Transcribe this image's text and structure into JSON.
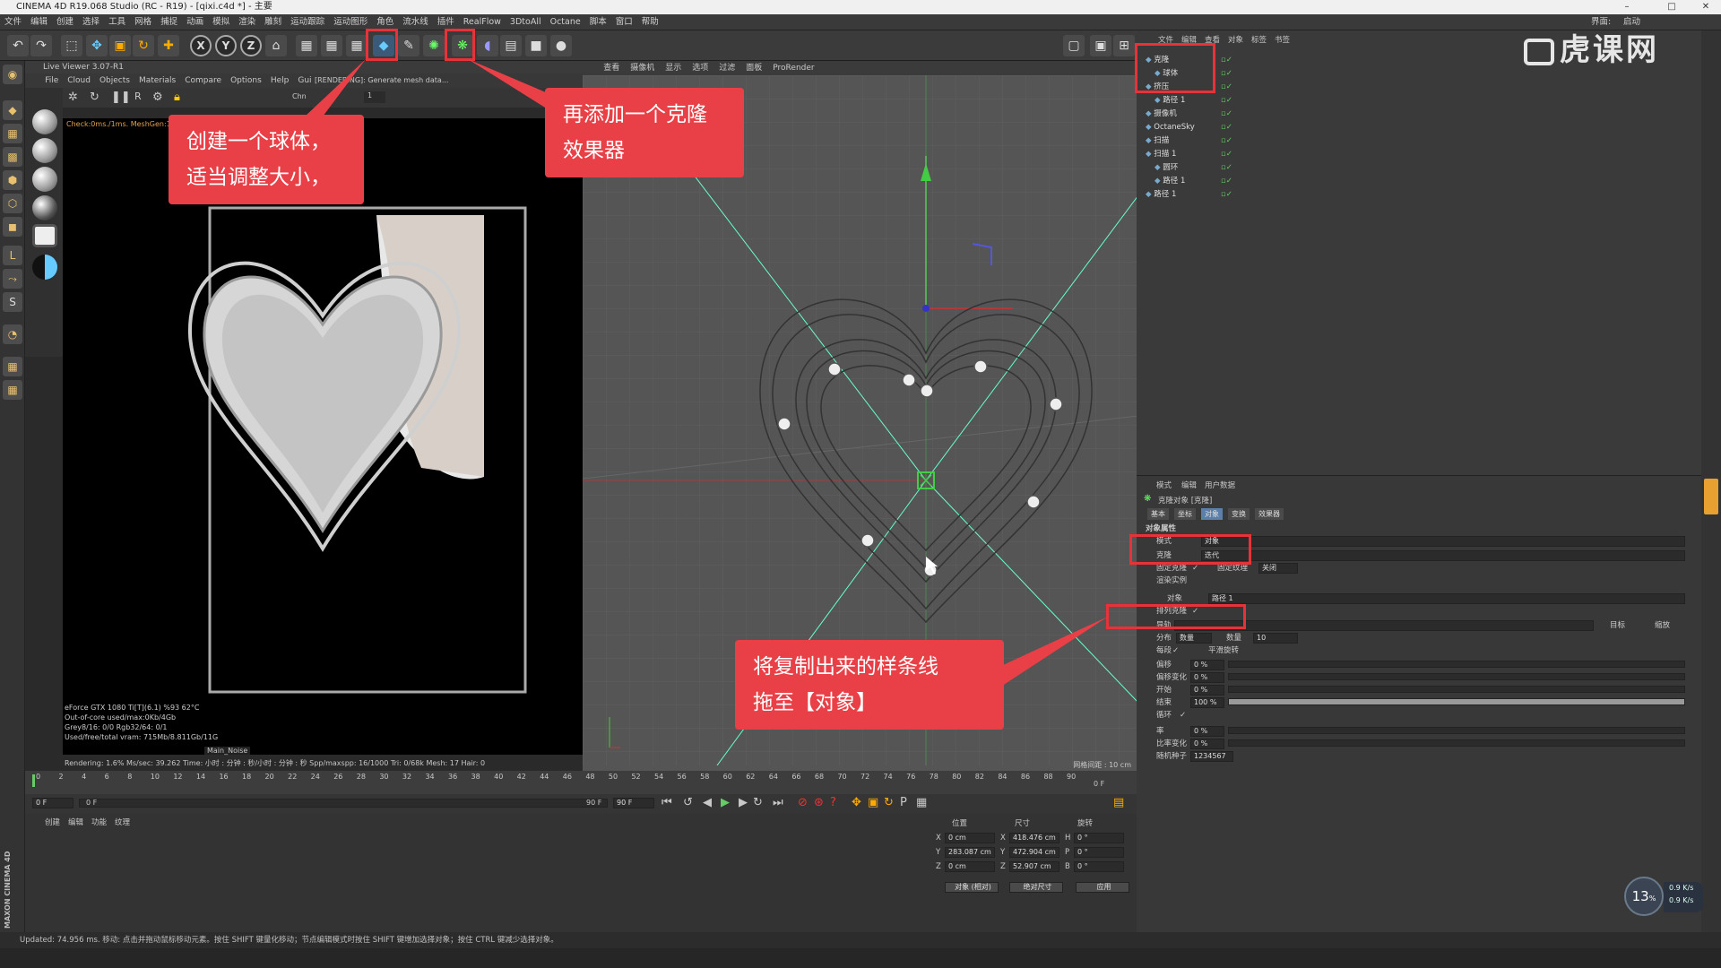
{
  "app": {
    "title": "CINEMA 4D R19.068 Studio (RC - R19) - [qixi.c4d *] - 主要"
  },
  "menu": [
    "文件",
    "编辑",
    "创建",
    "选择",
    "工具",
    "网格",
    "捕捉",
    "动画",
    "模拟",
    "渲染",
    "雕刻",
    "运动跟踪",
    "运动图形",
    "角色",
    "流水线",
    "插件",
    "RealFlow",
    "3DtoAll",
    "Octane",
    "脚本",
    "窗口",
    "帮助"
  ],
  "menu_right": [
    "界面:",
    "启动"
  ],
  "toolbar": {
    "axis_x": "X",
    "axis_y": "Y",
    "axis_z": "Z"
  },
  "live_viewer": {
    "title": "Live Viewer 3.07-R1",
    "menu": [
      "File",
      "Cloud",
      "Objects",
      "Materials",
      "Compare",
      "Options",
      "Help",
      "Gui"
    ],
    "render_msg": "[RENDERING]: Generate mesh data...",
    "check_msg": "Check:0ms./1ms. MeshGen:1...",
    "channel_label": "Chn",
    "frame_value": "1",
    "status_lines": [
      "eForce GTX 1080 Ti[T](6.1)  %93       62°C",
      "Out-of-core used/max:0Kb/4Gb",
      "Grey8/16: 0/0          Rgb32/64: 0/1",
      "Used/free/total vram: 715Mb/8.811Gb/11G"
    ],
    "noise_label": "Main_Noise",
    "rendering_line": "Rendering: 1.6%    Ms/sec: 39.262   Time: 小时 : 分钟 : 秒/小时 : 分钟 : 秒   Spp/maxspp: 16/1000    Tri: 0/68k   Mesh: 17   Hair: 0"
  },
  "viewport": {
    "menu": [
      "查看",
      "摄像机",
      "显示",
      "选项",
      "过滤",
      "面板",
      "ProRender"
    ],
    "grid_label": "网格间距 : 10 cm"
  },
  "object_manager": {
    "menu": [
      "文件",
      "编辑",
      "查看",
      "对象",
      "标签",
      "书签"
    ],
    "objects": [
      {
        "name": "克隆",
        "indent": 0
      },
      {
        "name": "球体",
        "indent": 1
      },
      {
        "name": "挤压",
        "indent": 0
      },
      {
        "name": "路径 1",
        "indent": 1
      },
      {
        "name": "摄像机",
        "indent": 0
      },
      {
        "name": "OctaneSky",
        "indent": 0
      },
      {
        "name": "扫描",
        "indent": 0
      },
      {
        "name": "扫描 1",
        "indent": 0
      },
      {
        "name": "圆环",
        "indent": 1
      },
      {
        "name": "路径 1",
        "indent": 1
      },
      {
        "name": "路径 1",
        "indent": 0
      }
    ]
  },
  "attribute_manager": {
    "menu": [
      "模式",
      "编辑",
      "用户数据"
    ],
    "object_title": "克隆对象 [克隆]",
    "tabs": [
      "基本",
      "坐标",
      "对象",
      "变换",
      "效果器"
    ],
    "section": "对象属性",
    "mode_label": "模式",
    "mode_value": "对象",
    "clone_label": "克隆",
    "clone_value": "迭代",
    "fix_clone_label": "固定克隆",
    "fix_clone_check": "✓",
    "fix_texture_label": "固定纹理",
    "fix_texture_value": "关闭",
    "instance_label": "渲染实例",
    "object_label": "对象",
    "object_value": "路径 1",
    "arrange_label": "排列克隆",
    "arrange_check": "✓",
    "upvector_label": "导轨",
    "target_label": "目标",
    "scale_label": "缩放",
    "distribute_label": "分布",
    "distribute_value": "数量",
    "count_label": "数量",
    "count_value": "10",
    "even_label": "每段",
    "even_check": "✓",
    "smooth_label": "平滑旋转",
    "offset_label": "偏移",
    "offset_value": "0 %",
    "offset_var_label": "偏移变化",
    "offset_var_value": "0 %",
    "start_label": "开始",
    "start_value": "0 %",
    "end_label": "结束",
    "end_value": "100 %",
    "end_fraction": 1.0,
    "loop_label": "循环",
    "loop_check": "✓",
    "rate_label": "率",
    "rate_value": "0 %",
    "rate_var_label": "比率变化",
    "rate_var_value": "0 %",
    "seed_label": "随机种子",
    "seed_value": "1234567"
  },
  "timeline": {
    "ticks": [
      "0",
      "2",
      "4",
      "6",
      "8",
      "10",
      "12",
      "14",
      "16",
      "18",
      "20",
      "22",
      "24",
      "26",
      "28",
      "30",
      "32",
      "34",
      "36",
      "38",
      "40",
      "42",
      "44",
      "46",
      "48",
      "50",
      "52",
      "54",
      "56",
      "58",
      "60",
      "62",
      "64",
      "66",
      "68",
      "70",
      "72",
      "74",
      "76",
      "78",
      "80",
      "82",
      "84",
      "86",
      "88",
      "90"
    ],
    "current_frame": "0 F",
    "start_field": "0 F",
    "min_field": "0 F",
    "max_field": "90 F",
    "end_field": "90 F"
  },
  "material_manager": {
    "menu": [
      "创建",
      "编辑",
      "功能",
      "纹理"
    ]
  },
  "coordinates": {
    "headers": [
      "位置",
      "尺寸",
      "旋转"
    ],
    "rows": [
      {
        "axis": "X",
        "pos": "0 cm",
        "sizeaxis": "X",
        "size": "418.476 cm",
        "rotaxis": "H",
        "rot": "0 °"
      },
      {
        "axis": "Y",
        "pos": "283.087 cm",
        "sizeaxis": "Y",
        "size": "472.904 cm",
        "rotaxis": "P",
        "rot": "0 °"
      },
      {
        "axis": "Z",
        "pos": "0 cm",
        "sizeaxis": "Z",
        "size": "52.907 cm",
        "rotaxis": "B",
        "rot": "0 °"
      }
    ],
    "mode_btn": "对象 (相对)",
    "size_btn": "绝对尺寸",
    "apply_btn": "应用"
  },
  "statusbar": {
    "text": "Updated: 74.956 ms.    移动: 点击并拖动鼠标移动元素。按住 SHIFT 键量化移动；节点编辑模式时按住 SHIFT 键增加选择对象；按住 CTRL 键减少选择对象。"
  },
  "callouts": {
    "c1_line1": "创建一个球体，",
    "c1_line2": "适当调整大小，",
    "c2_line1": "再添加一个克隆",
    "c2_line2": "效果器",
    "c3_line1": "将复制出来的样条线",
    "c3_line2": "拖至【对象】"
  },
  "watermark": "虎课网",
  "netspeed": {
    "percent": "13",
    "unit": "%",
    "up": "0.9",
    "down": "0.9",
    "rate_unit": "K/s"
  },
  "brand": "MAXON CINEMA 4D",
  "colors": {
    "callout": "#e94047",
    "highlight": "#e8323a",
    "viewport_bg": "#555555",
    "spline": "#222222"
  }
}
